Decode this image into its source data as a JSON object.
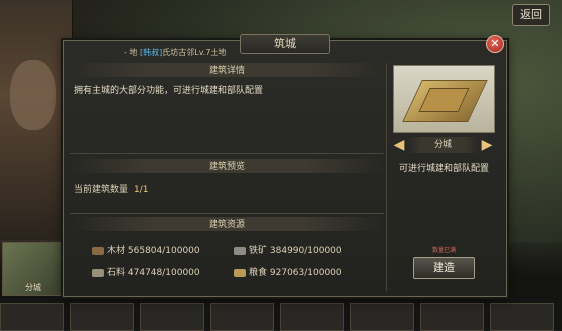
{
  "top": {
    "back_label": "返回"
  },
  "dialog": {
    "title": "筑城",
    "subtitle_prefix": "- 地",
    "subtitle_tag": "[韩叔]",
    "subtitle_rest": "氏坊古邻Lv.7土地"
  },
  "details": {
    "header": "建筑详情",
    "description": "拥有主城的大部分功能，可进行城建和部队配置"
  },
  "preview": {
    "header": "建筑预览",
    "label": "当前建筑数量",
    "value": "1/1"
  },
  "resources": {
    "header": "建筑资源",
    "items": [
      {
        "icon": "wood-icon",
        "name": "木材",
        "value": "565804/100000"
      },
      {
        "icon": "iron-icon",
        "name": "铁矿",
        "value": "384990/100000"
      },
      {
        "icon": "stone-icon",
        "name": "石料",
        "value": "474748/100000"
      },
      {
        "icon": "food-icon",
        "name": "粮食",
        "value": "927063/100000"
      }
    ]
  },
  "building": {
    "name": "分城",
    "description": "可进行城建和部队配置",
    "requirement": "数量已满",
    "build_label": "建造"
  },
  "bottom": {
    "thumb_label": "分城"
  },
  "colors": {
    "accent_gold": "#f0c97a",
    "close_red": "#a8261d",
    "level_blue": "#5ab7e6"
  }
}
